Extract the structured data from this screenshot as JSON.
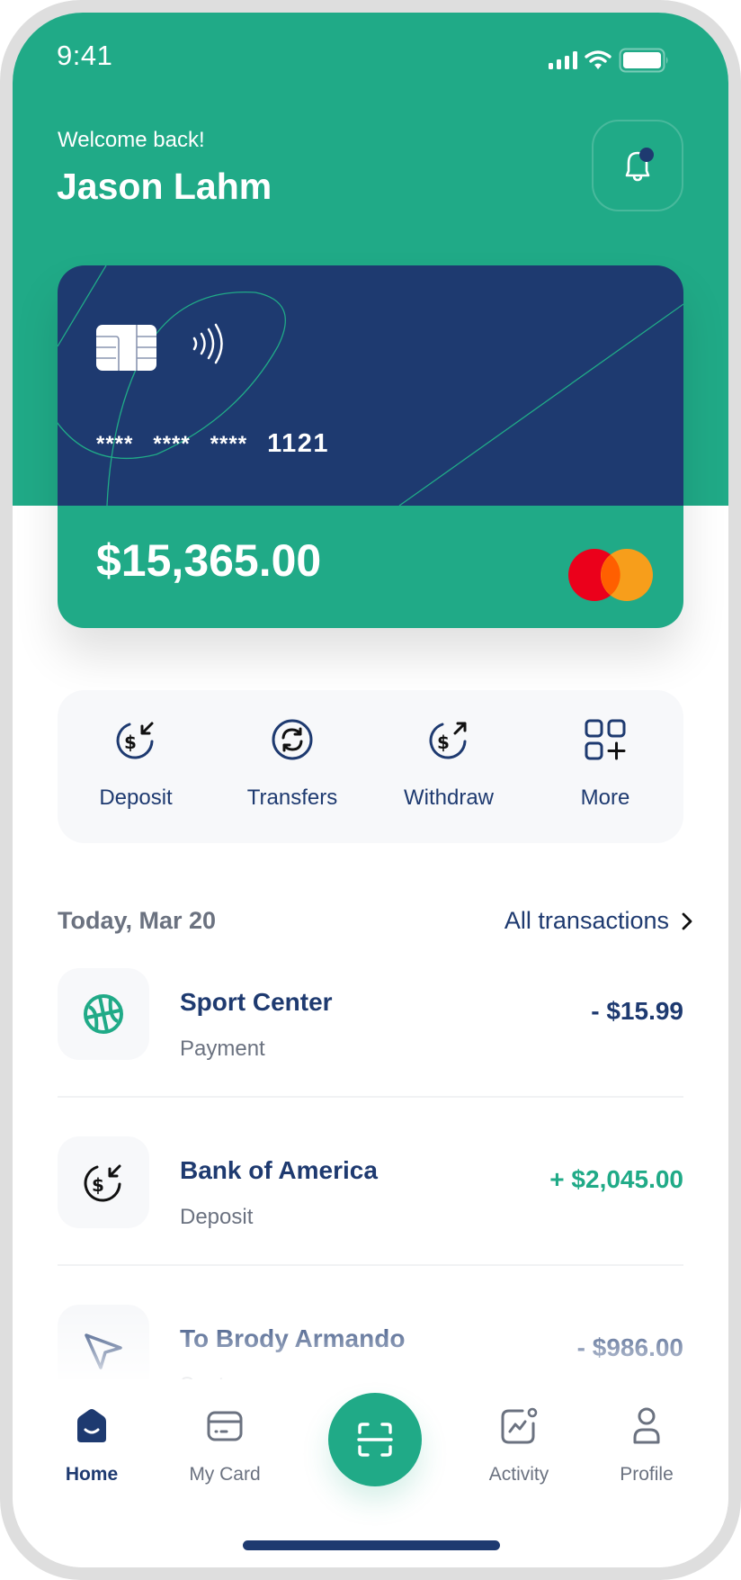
{
  "status_bar": {
    "time": "9:41"
  },
  "header": {
    "greeting": "Welcome back!",
    "user_name": "Jason Lahm",
    "notification_badge": true
  },
  "card": {
    "number_masked": [
      "****",
      "****",
      "****"
    ],
    "last_four": "1121",
    "balance": "$15,365.00",
    "network": "Mastercard"
  },
  "quick_actions": [
    {
      "label": "Deposit",
      "icon": "deposit-icon"
    },
    {
      "label": "Transfers",
      "icon": "transfer-icon"
    },
    {
      "label": "Withdraw",
      "icon": "withdraw-icon"
    },
    {
      "label": "More",
      "icon": "more-grid-icon"
    }
  ],
  "transactions": {
    "date_label": "Today, Mar 20",
    "all_link": "All transactions",
    "items": [
      {
        "name": "Sport Center",
        "type": "Payment",
        "amount": "- $15.99",
        "direction": "out",
        "icon": "basketball-icon"
      },
      {
        "name": "Bank of America",
        "type": "Deposit",
        "amount": "+ $2,045.00",
        "direction": "in",
        "icon": "deposit-icon"
      },
      {
        "name": "To Brody Armando",
        "type": "Sent",
        "amount": "- $986.00",
        "direction": "out",
        "icon": "send-icon"
      }
    ]
  },
  "bottom_nav": [
    {
      "label": "Home",
      "active": true
    },
    {
      "label": "My Card",
      "active": false
    },
    {
      "label": "Activity",
      "active": false
    },
    {
      "label": "Profile",
      "active": false
    }
  ],
  "colors": {
    "primary_green": "#20aa87",
    "navy": "#1e3a70",
    "muted_text": "#6b7280",
    "surface": "#f7f8fa"
  }
}
